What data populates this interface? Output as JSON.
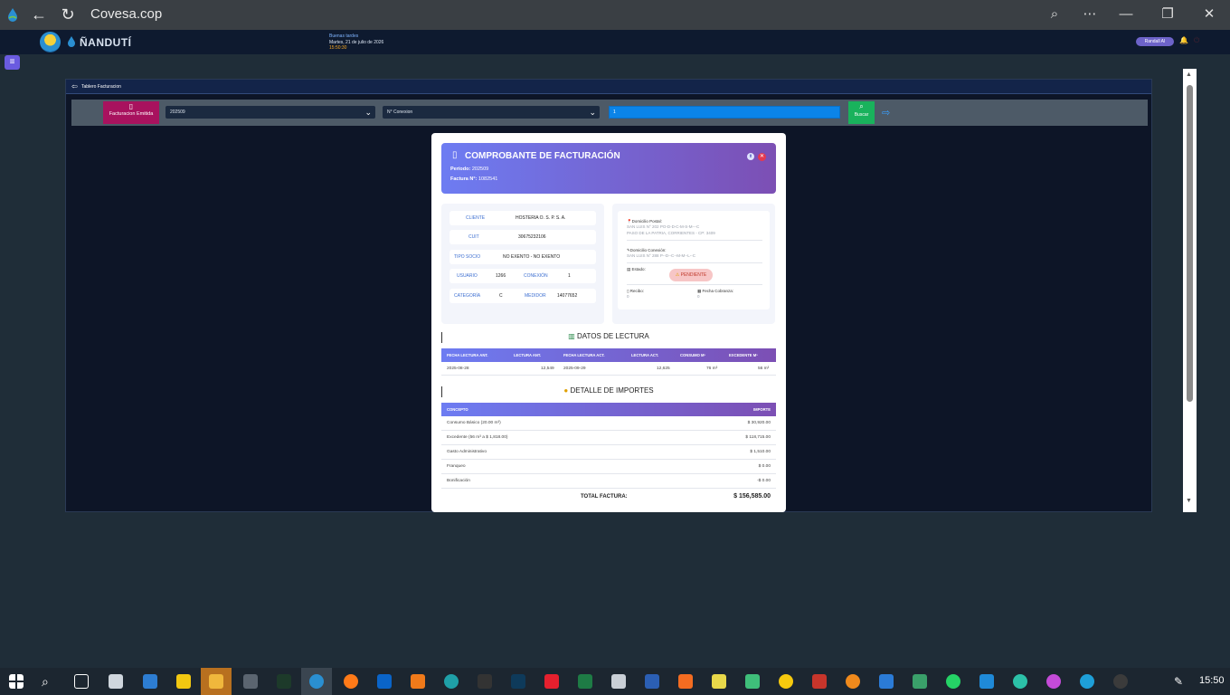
{
  "browser": {
    "title": "Covesa.cop"
  },
  "header": {
    "logo_text": "ÑANDUTÍ",
    "greeting": "Buenas tardes",
    "date": "Martes, 21 de julio de 2026",
    "time": "15:50:30",
    "user": "Randall AI"
  },
  "panel": {
    "title": "Tablero Facturacion",
    "emit_button": "Facturacion Emitida",
    "period_select": "202509",
    "field_select": "N° Conexion",
    "search_value": "1",
    "search_button": "Buscar"
  },
  "invoice": {
    "title": "COMPROBANTE DE FACTURACIÓN",
    "periodo_label": "Período:",
    "periodo": "202509",
    "factura_label": "Factura N°:",
    "factura": "1082541",
    "client": {
      "cliente_label": "CLIENTE",
      "cliente": "HOSTERIA O. S. P. S. A.",
      "cuit_label": "CUIT",
      "cuit": "30675232106",
      "tipo_label": "TIPO SOCIO",
      "tipo": "NO EXENTO - NO EXENTO",
      "usuario_label": "USUARIO",
      "usuario": "1266",
      "conexion_label": "CONEXIÓN",
      "conexion": "1",
      "categoria_label": "CATEGORÍA",
      "categoria": "C",
      "medidor_label": "MEDIDOR",
      "medidor": "14077652"
    },
    "address": {
      "postal_label": "Domicilio Postal:",
      "postal_1": "SAN LUIS N° 202 PO-D-D-C-M-S-M---C",
      "postal_2": "PASO DE LA PATRIA, CORRIENTES - CP: 3409",
      "conexion_label": "Domicilio Conexión:",
      "conexion_1": "SAN LUIS N° 288 P--D--C--M-M--L--C",
      "estado_label": "Estado:",
      "estado": "PENDIENTE",
      "recibo_label": "Recibo:",
      "recibo": "0",
      "fecha_cob_label": "Fecha Cobranza:",
      "fecha_cob": "0"
    },
    "lectura": {
      "title": "DATOS DE LECTURA",
      "headers": [
        "FECHA LECTURA ANT.",
        "LECTURA ANT.",
        "FECHA LECTURA ACT.",
        "LECTURA ACT.",
        "CONSUMO M³",
        "EXCEDENTE M³"
      ],
      "row": [
        "2025-08-28",
        "12,549",
        "2025-09-29",
        "12,625",
        "76 m³",
        "56 m³"
      ]
    },
    "importes": {
      "title": "DETALLE DE IMPORTES",
      "headers": [
        "CONCEPTO",
        "IMPORTE"
      ],
      "rows": [
        [
          "Consumo Básico (20.00 m³)",
          "$ 30,920.00"
        ],
        [
          "Excedente (56 m³ a $ 1,818.00)",
          "$ 118,715.00"
        ],
        [
          "Gasto Administrativo",
          "$ 1,510.00"
        ],
        [
          "Franqueo",
          "$ 0.00"
        ],
        [
          "Bonificación",
          "-$ 0.00"
        ]
      ],
      "total_label": "TOTAL FACTURA:",
      "total": "$ 156,585.00"
    }
  },
  "taskbar": {
    "time": "15:50"
  }
}
